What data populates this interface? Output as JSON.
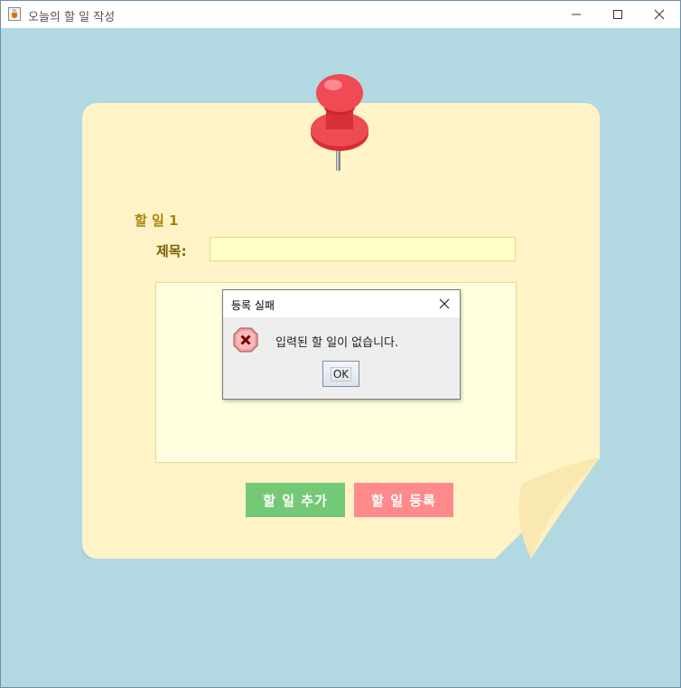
{
  "window": {
    "title": "오늘의 할 일 작성",
    "icon": "java-cup-icon"
  },
  "form": {
    "section_label": "할 일 1",
    "title_label": "제목:",
    "title_value": "",
    "content_value": ""
  },
  "buttons": {
    "add_label": "할 일 추가",
    "submit_label": "할 일 등록"
  },
  "dialog": {
    "title": "등록 실패",
    "message": "입력된 할 일이 없습니다.",
    "ok_label": "OK",
    "icon": "error-icon"
  },
  "colors": {
    "background": "#b2d9e2",
    "note": "#fff3c7",
    "add_button": "#73c975",
    "submit_button": "#ff8a8b",
    "label": "#a8860a"
  }
}
